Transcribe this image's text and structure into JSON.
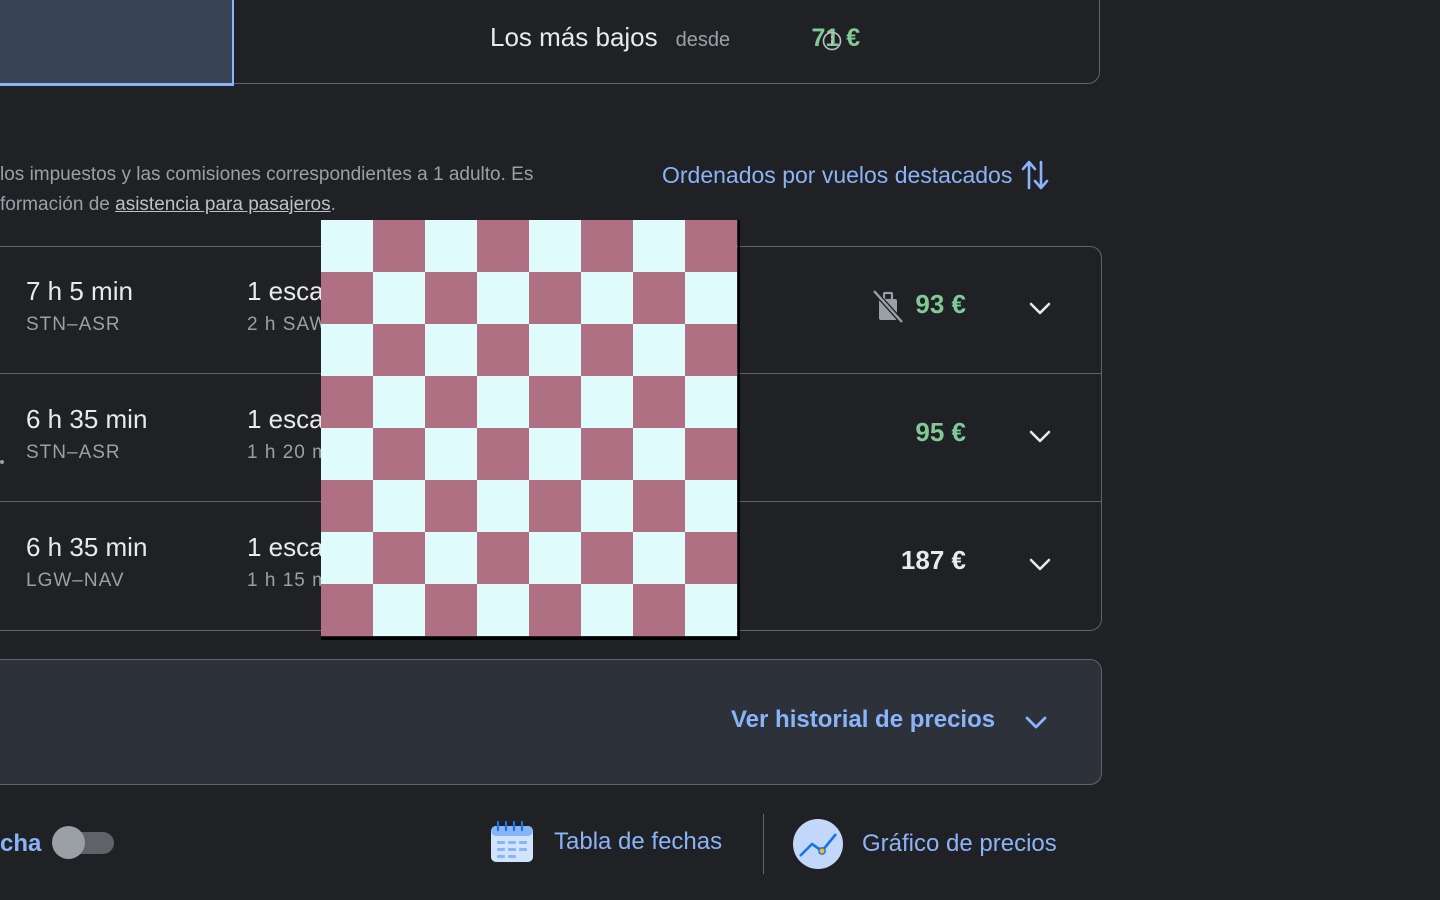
{
  "sort_tabs": {
    "lowest_label": "Los más bajos",
    "lowest_from": "desde",
    "lowest_price": "71 €"
  },
  "note": {
    "line1": "los impuestos y las comisiones correspondientes a 1 adulto. Es",
    "line2_prefix": "formación de ",
    "line2_link": "asistencia para pasajeros",
    "line2_suffix": "."
  },
  "sort_button": {
    "label": "Ordenados por vuelos destacados"
  },
  "results": [
    {
      "duration": "7 h 5 min",
      "route": "STN–ASR",
      "stops": "1 escala",
      "layover": "2 h SAW",
      "price": "93 €",
      "price_color": "#81c995",
      "no_bag_icon": true
    },
    {
      "duration": "6 h 35 min",
      "route": "STN–ASR",
      "stops": "1 escala",
      "layover": "1 h 20 min",
      "price": "95 €",
      "price_color": "#81c995",
      "no_bag_icon": false
    },
    {
      "duration": "6 h 35 min",
      "route": "LGW–NAV",
      "stops": "1 escala",
      "layover": "1 h 15 min",
      "price": "187 €",
      "price_color": "#e8eaed",
      "no_bag_icon": false
    }
  ],
  "price_history": {
    "label": "Ver historial de precios"
  },
  "bottom_bar": {
    "date_toggle_label": "cha",
    "date_grid_label": "Tabla de fechas",
    "price_graph_label": "Gráfico de precios"
  }
}
